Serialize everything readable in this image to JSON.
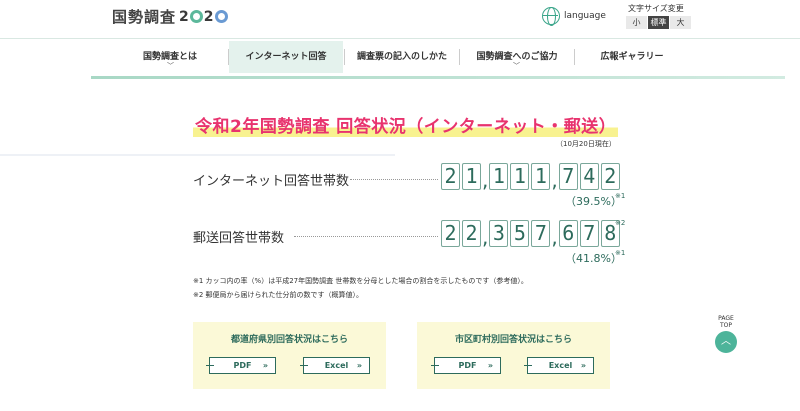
{
  "header": {
    "logo_text": "国勢調査",
    "logo_year": "2020",
    "language_label": "language",
    "font_size": {
      "title": "文字サイズ変更",
      "options": [
        "小",
        "標準",
        "大"
      ],
      "active": "標準"
    }
  },
  "nav": {
    "items": [
      {
        "label": "国勢調査とは",
        "chevron": "﹀"
      },
      {
        "label": "インターネット回答",
        "chevron": ""
      },
      {
        "label": "調査票の記入のしかた",
        "chevron": ""
      },
      {
        "label": "国勢調査へのご協力",
        "chevron": "﹀"
      },
      {
        "label": "広報ギャラリー",
        "chevron": ""
      }
    ],
    "active_index": 1
  },
  "main": {
    "title": "令和2年国勢調査 回答状況（インターネット・郵送）",
    "date_note": "（10月20日現在）",
    "rows": [
      {
        "label": "インターネット回答世帯数",
        "digits": [
          "2",
          "1",
          ",",
          "1",
          "1",
          "1",
          ",",
          "7",
          "4",
          "2"
        ],
        "value": "21,111,742",
        "percent": "（39.5%）",
        "percent_mark": "※1",
        "value_mark": ""
      },
      {
        "label": "郵送回答世帯数",
        "digits": [
          "2",
          "2",
          ",",
          "3",
          "5",
          "7",
          ",",
          "6",
          "7",
          "8"
        ],
        "value": "22,357,678",
        "percent": "（41.8%）",
        "percent_mark": "※1",
        "value_mark": "※2"
      }
    ],
    "footnotes": [
      "※1 カッコ内の率（%）は平成27年国勢調査 世帯数を分母とした場合の割合を示したものです（参考値）。",
      "※2 郵便局から届けられた仕分前の数です（概算値）。"
    ]
  },
  "boxes": [
    {
      "title": "都道府県別回答状況はこちら",
      "pdf": "PDF",
      "excel": "Excel"
    },
    {
      "title": "市区町村別回答状況はこちら",
      "pdf": "PDF",
      "excel": "Excel"
    }
  ],
  "page_top": {
    "line1": "PAGE",
    "line2": "TOP",
    "icon": "chevron-up-icon"
  },
  "colors": {
    "accent_green": "#2d6b5c",
    "title_pink": "#e8336e",
    "highlight_yellow": "#f8f290",
    "box_bg": "#fbf9d7",
    "pagetop_bg": "#4db49a"
  }
}
